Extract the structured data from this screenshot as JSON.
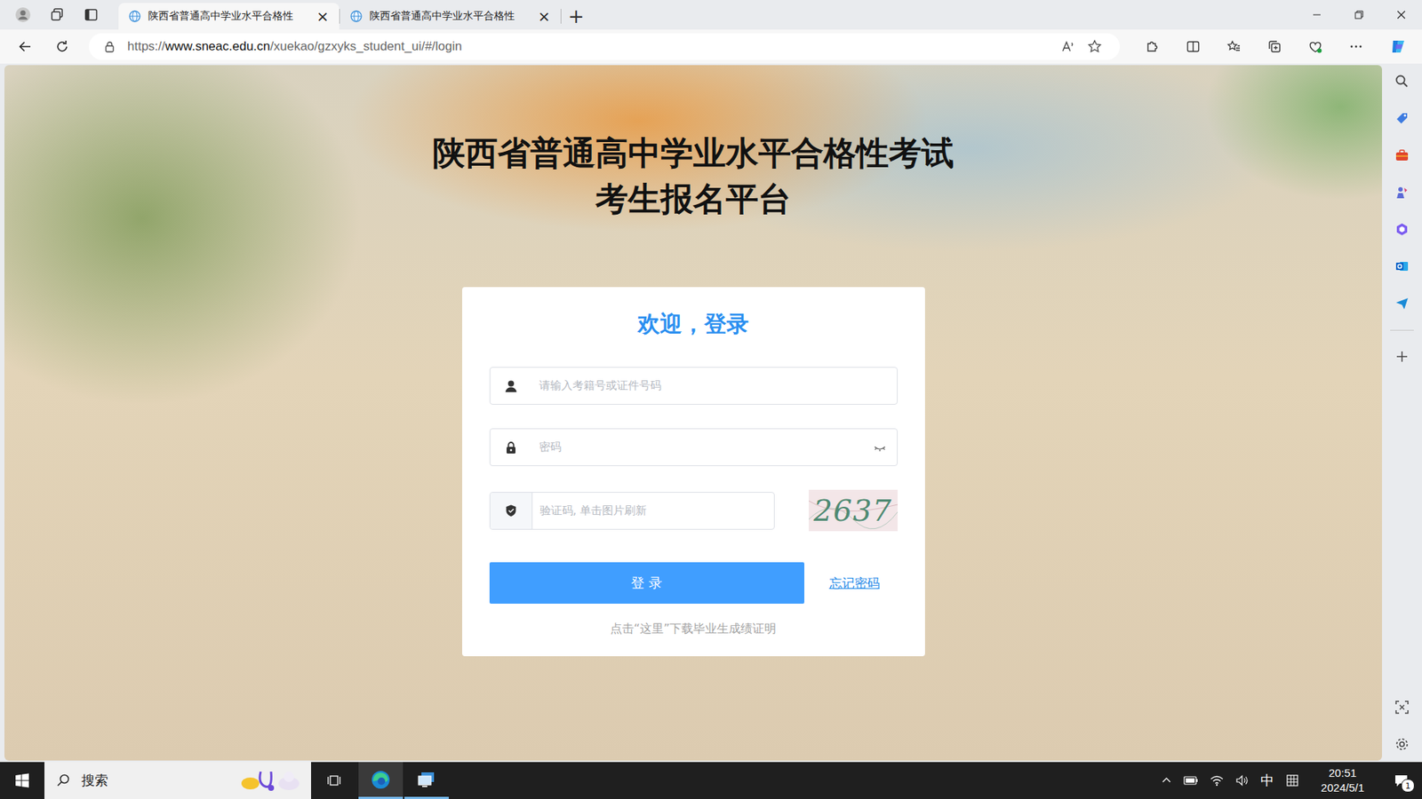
{
  "browser": {
    "tabs": [
      {
        "label": "陕西省普通高中学业水平合格性",
        "selected": true,
        "close": "×"
      },
      {
        "label": "陕西省普通高中学业水平合格性",
        "selected": false,
        "close": "×"
      }
    ],
    "new_tab": "+",
    "address": {
      "scheme": "https://",
      "host": "www.sneac.edu.cn",
      "path": "/xuekao/gzxyks_student_ui/#/login"
    }
  },
  "page": {
    "title_lines": [
      "陕西省普通高中学业水平合格性考试",
      "考生报名平台"
    ],
    "login": {
      "heading": "欢迎，登录",
      "fields": [
        {
          "kind": "text",
          "placeholder": "请输入考籍号或证件号码"
        },
        {
          "kind": "password",
          "placeholder": "密码"
        },
        {
          "kind": "captcha",
          "placeholder": "验证码, 单击图片刷新"
        }
      ],
      "captcha_code": "2637",
      "submit": "登 录",
      "forgot": "忘记密码",
      "footer": "点击“这里”下载毕业生成绩证明"
    }
  },
  "taskbar": {
    "search": "搜索",
    "ime": "中",
    "time": "20:51",
    "date": "2024/5/1",
    "notifications": "1"
  }
}
